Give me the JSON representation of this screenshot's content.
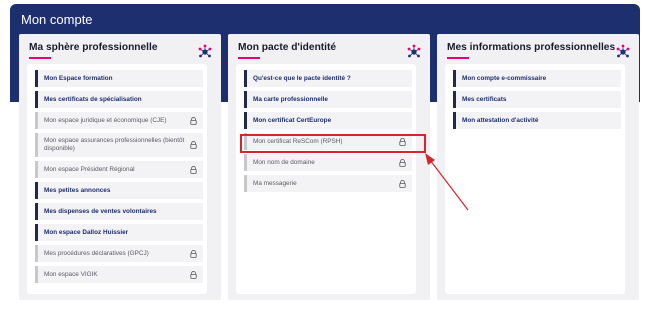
{
  "header": {
    "title": "Mon compte"
  },
  "columns": [
    {
      "title": "Ma sphère professionnelle",
      "icon": "network-icon",
      "items": [
        {
          "label": "Mon Espace formation",
          "style": "bold"
        },
        {
          "label": "Mes certificats de spécialisation",
          "style": "bold"
        },
        {
          "label": "Mon espace juridique et économique (CJE)",
          "style": "locked"
        },
        {
          "label": "Mon espace assurances professionnelles (bientôt disponible)",
          "style": "locked"
        },
        {
          "label": "Mon espace Président Régional",
          "style": "locked"
        },
        {
          "label": "Mes petites annonces",
          "style": "bold"
        },
        {
          "label": "Mes dispenses de ventes volontaires",
          "style": "bold"
        },
        {
          "label": "Mon espace Dalloz Huissier",
          "style": "bold"
        },
        {
          "label": "Mes procédures déclaratives (GPCJ)",
          "style": "locked"
        },
        {
          "label": "Mon espace VIGIK",
          "style": "locked"
        }
      ]
    },
    {
      "title": "Mon pacte d'identité",
      "icon": "network-icon",
      "items": [
        {
          "label": "Qu'est-ce que le pacte identité ?",
          "style": "bold"
        },
        {
          "label": "Ma carte professionnelle",
          "style": "bold"
        },
        {
          "label": "Mon certificat CertEurope",
          "style": "bold"
        },
        {
          "label": "Mon certificat ReSCom (RPSH)",
          "style": "locked"
        },
        {
          "label": "Mon nom de domaine",
          "style": "locked"
        },
        {
          "label": "Ma messagerie",
          "style": "locked"
        }
      ]
    },
    {
      "title": "Mes informations professionnelles",
      "icon": "network-icon",
      "items": [
        {
          "label": "Mon compte e-commissaire",
          "style": "bold"
        },
        {
          "label": "Mes certificats",
          "style": "bold"
        },
        {
          "label": "Mon attestation d'activité",
          "style": "bold"
        }
      ]
    }
  ],
  "colors": {
    "banner": "#1d2f6f",
    "accent": "#e6007e",
    "highlight": "#d9232d"
  }
}
